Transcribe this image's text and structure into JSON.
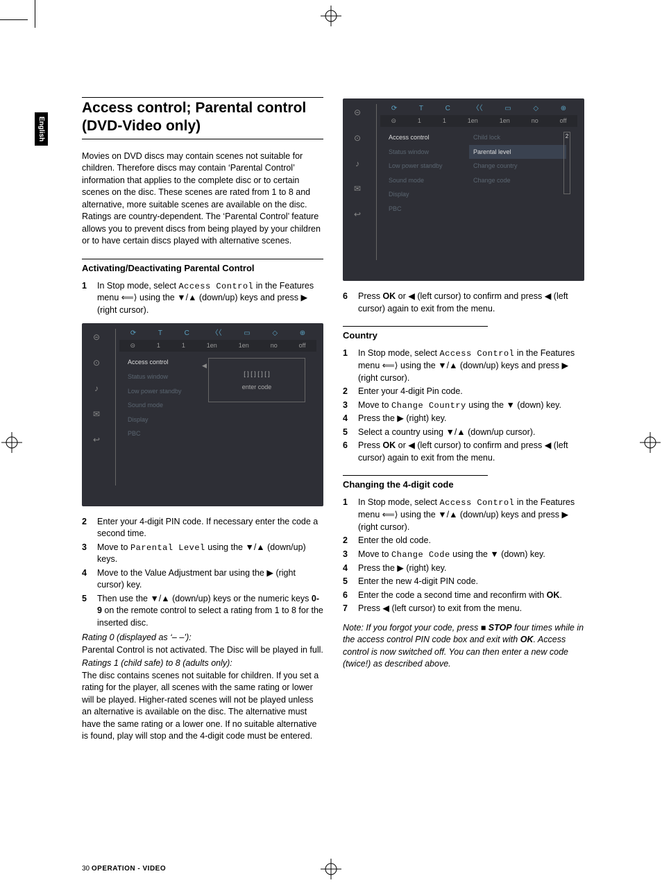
{
  "language_tab": "English",
  "title": "Access control; Parental control (DVD-Video only)",
  "intro": "Movies on DVD discs may contain scenes not suitable for children. Therefore discs may contain ‘Parental Control’ information that applies to the complete disc or to certain scenes on the disc. These scenes are rated from 1 to 8 and alternative, more suitable scenes are available on the disc. Ratings are country-dependent. The ‘Parental Control’ feature allows you to prevent discs from being played by your children or to have certain discs played with alternative scenes.",
  "h_activate": "Activating/Deactivating Parental Control",
  "steps_a": {
    "s1a": "In Stop mode, select ",
    "s1b": "Access Control",
    "s1c": " in the Features menu ",
    "s1d": " using the ▼/▲ (down/up) keys and press ▶ (right cursor).",
    "s2": "Enter your 4-digit PIN code. If necessary enter the code a second time.",
    "s3a": "Move to ",
    "s3b": "Parental Level",
    "s3c": " using the ▼/▲ (down/up) keys.",
    "s4": "Move to the Value Adjustment bar using the ▶ (right cursor) key.",
    "s5a": "Then use the ▼/▲ (down/up) keys or the numeric keys ",
    "s5b": "0-9",
    "s5c": " on the remote control to select a rating from 1 to 8 for the inserted disc."
  },
  "rating0_head": "Rating 0 (displayed as ‘– –’):",
  "rating0_body": "Parental Control is not activated. The Disc will be played in full.",
  "rating1_head": "Ratings 1 (child safe) to 8 (adults only):",
  "rating1_body": "The disc contains scenes not suitable for children. If you set a rating for the player, all scenes with the same rating or lower will be played. Higher-rated scenes will not be played unless an alternative is available on the disc. The alternative must have the same rating or a lower one. If no suitable alternative is found, play will stop and the 4-digit code must be entered.",
  "step6a": "Press ",
  "step6b": "OK",
  "step6c": " or ◀ (left cursor) to confirm and press ◀ (left cursor) again to exit from the menu.",
  "h_country": "Country",
  "country": {
    "s1a": "In Stop mode, select ",
    "s1b": "Access Control",
    "s1c": " in the Features menu ",
    "s1d": " using the ▼/▲ (down/up) keys and press ▶ (right cursor).",
    "s2": "Enter your 4-digit Pin code.",
    "s3a": "Move to ",
    "s3b": "Change Country",
    "s3c": " using the ▼ (down) key.",
    "s4": "Press the ▶ (right) key.",
    "s5": "Select a country using ▼/▲ (down/up cursor).",
    "s6a": "Press ",
    "s6b": "OK",
    "s6c": " or ◀ (left cursor) to confirm and press ◀ (left cursor) again to exit from the menu."
  },
  "h_changecode": "Changing the 4-digit code",
  "code": {
    "s1a": "In Stop mode, select ",
    "s1b": "Access Control",
    "s1c": " in the Features menu ",
    "s1d": " using the ▼/▲ (down/up) keys and press ▶ (right cursor).",
    "s2": "Enter the old code.",
    "s3a": "Move to ",
    "s3b": "Change Code",
    "s3c": " using the ▼ (down) key.",
    "s4": "Press the ▶ (right) key.",
    "s5": "Enter the new 4-digit PIN code.",
    "s6a": "Enter the code a second time and reconfirm with ",
    "s6b": "OK",
    "s6c": ".",
    "s7": "Press ◀ (left cursor) to exit from the menu."
  },
  "forgot_a": "Note: If you forgot your code, press ■ ",
  "forgot_b": "STOP",
  "forgot_c": " four times while in the access control PIN code box and exit with ",
  "forgot_d": "OK",
  "forgot_e": ". Access control is now switched off. You can then enter a new code (twice!) as described above.",
  "shot": {
    "top": [
      "⟳",
      "T",
      "C",
      "〈〈",
      "▭",
      "◇",
      "⊕"
    ],
    "vals": [
      "⊝",
      "1",
      "1",
      "1en",
      "1en",
      "no",
      "off"
    ],
    "menu": [
      "Access control",
      "Status window",
      "Low power standby",
      "Sound mode",
      "Display",
      "PBC"
    ],
    "code_placeholder": "[ ] [ ] [ ] [ ]",
    "enter_code": "enter code",
    "r2": [
      "Child lock",
      "Parental level",
      "Change country",
      "Change code"
    ],
    "level": "2"
  },
  "footer_page": "30",
  "footer_section": "OPERATION - VIDEO"
}
